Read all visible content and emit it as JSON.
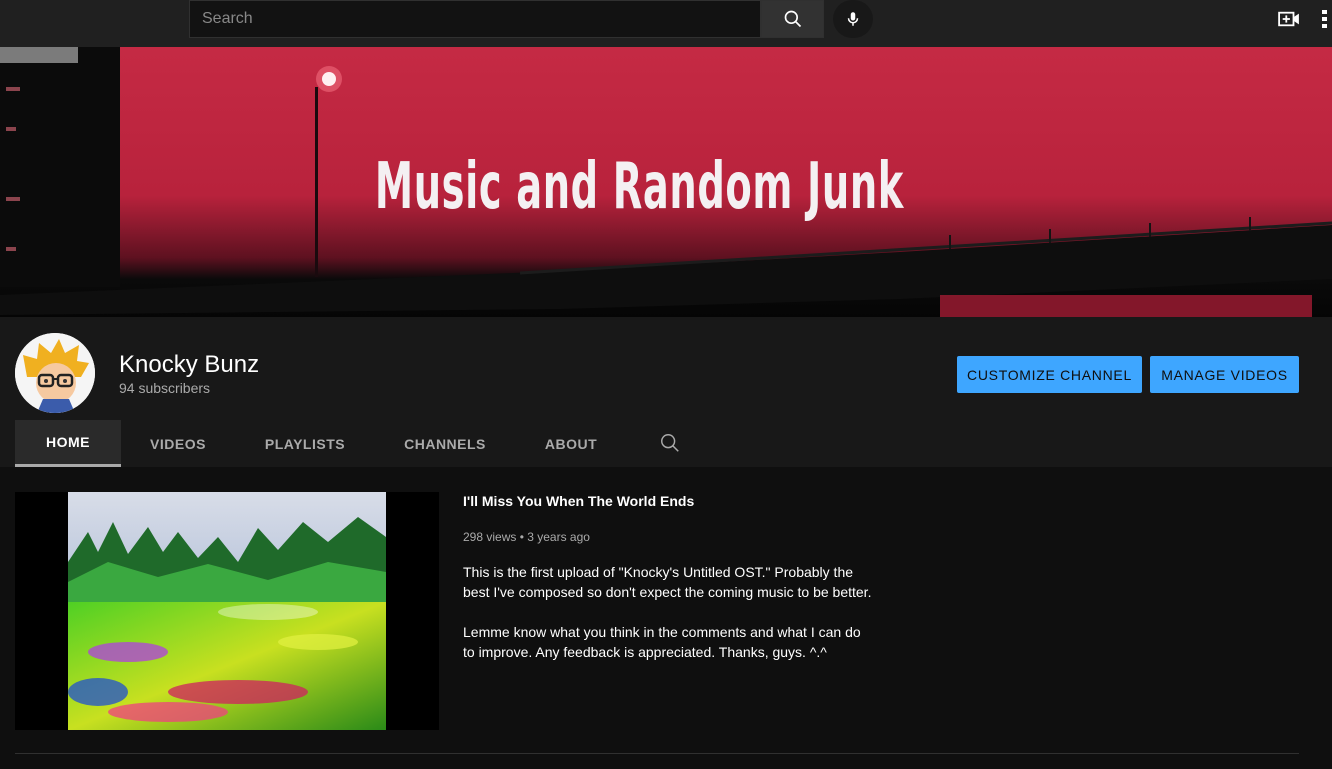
{
  "topbar": {
    "search_placeholder": "Search",
    "icons": [
      "search-icon",
      "mic-icon",
      "create-video-icon",
      "apps-icon"
    ]
  },
  "banner": {
    "title": "Music and Random Junk"
  },
  "channel": {
    "name": "Knocky Bunz",
    "subscribers": "94 subscribers",
    "customize_label": "CUSTOMIZE CHANNEL",
    "manage_label": "MANAGE VIDEOS",
    "accent_color": "#3ea6ff"
  },
  "tabs": [
    {
      "label": "HOME",
      "active": true
    },
    {
      "label": "VIDEOS",
      "active": false
    },
    {
      "label": "PLAYLISTS",
      "active": false
    },
    {
      "label": "CHANNELS",
      "active": false
    },
    {
      "label": "ABOUT",
      "active": false
    }
  ],
  "featured_video": {
    "title": "I'll Miss You When The World Ends",
    "views": "298 views",
    "age": "3 years ago",
    "meta": "298 views • 3 years ago",
    "description": "This is the first upload of \"Knocky's Untitled OST.\" Probably the best I've composed so don't expect the coming music to be better.\n\nLemme know what you think in the comments and what I can do to improve. Any feedback is appreciated. Thanks, guys. ^.^"
  }
}
